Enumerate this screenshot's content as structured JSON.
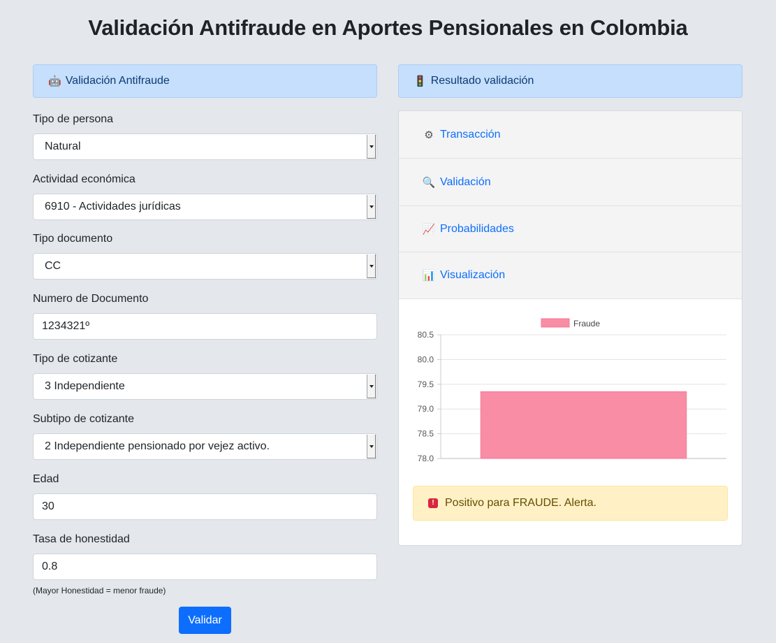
{
  "page": {
    "title": "Validación Antifraude en Aportes Pensionales en Colombia"
  },
  "form": {
    "header": {
      "icon": "robot-icon",
      "title": "Validación Antifraude"
    },
    "fields": [
      {
        "label": "Tipo de persona",
        "value": "Natural",
        "type": "select"
      },
      {
        "label": "Actividad económica",
        "value": "6910 - Actividades jurídicas",
        "type": "select"
      },
      {
        "label": "Tipo documento",
        "value": "CC",
        "type": "select"
      },
      {
        "label": "Numero de Documento",
        "value": "1234321º",
        "type": "input"
      },
      {
        "label": "Tipo de cotizante",
        "value": "3 Independiente",
        "type": "select"
      },
      {
        "label": "Subtipo de cotizante",
        "value": "2 Independiente pensionado por vejez activo.",
        "type": "select"
      },
      {
        "label": "Edad",
        "value": "30",
        "type": "input"
      },
      {
        "label": "Tasa de honestidad",
        "value": "0.8",
        "type": "input"
      }
    ],
    "hint": "(Mayor Honestidad = menor fraude)",
    "submit_label": "Validar"
  },
  "result": {
    "header": {
      "icon": "traffic-light-icon",
      "title": "Resultado validación"
    },
    "accordion": [
      {
        "icon": "gear-icon",
        "label": "Transacción"
      },
      {
        "icon": "magnifier-icon",
        "label": "Validación"
      },
      {
        "icon": "trend-chart-icon",
        "label": "Probabilidades"
      },
      {
        "icon": "bar-chart-icon",
        "label": "Visualización"
      }
    ],
    "alert": {
      "icon": "siren-icon",
      "text": "Positivo para FRAUDE. Alerta."
    }
  },
  "colors": {
    "accent": "#0d6efd",
    "bar": "#f98da5",
    "alert_bg": "#fff1c5",
    "header_bg": "#c5dffc"
  },
  "chart_data": {
    "type": "bar",
    "categories": [
      ""
    ],
    "series": [
      {
        "name": "Fraude",
        "values": [
          79.35
        ]
      }
    ],
    "ylim": [
      78.0,
      80.5
    ],
    "yticks": [
      "80.5",
      "80.0",
      "79.5",
      "79.0",
      "78.5",
      "78.0"
    ],
    "legend": "top-center",
    "grid": true
  }
}
